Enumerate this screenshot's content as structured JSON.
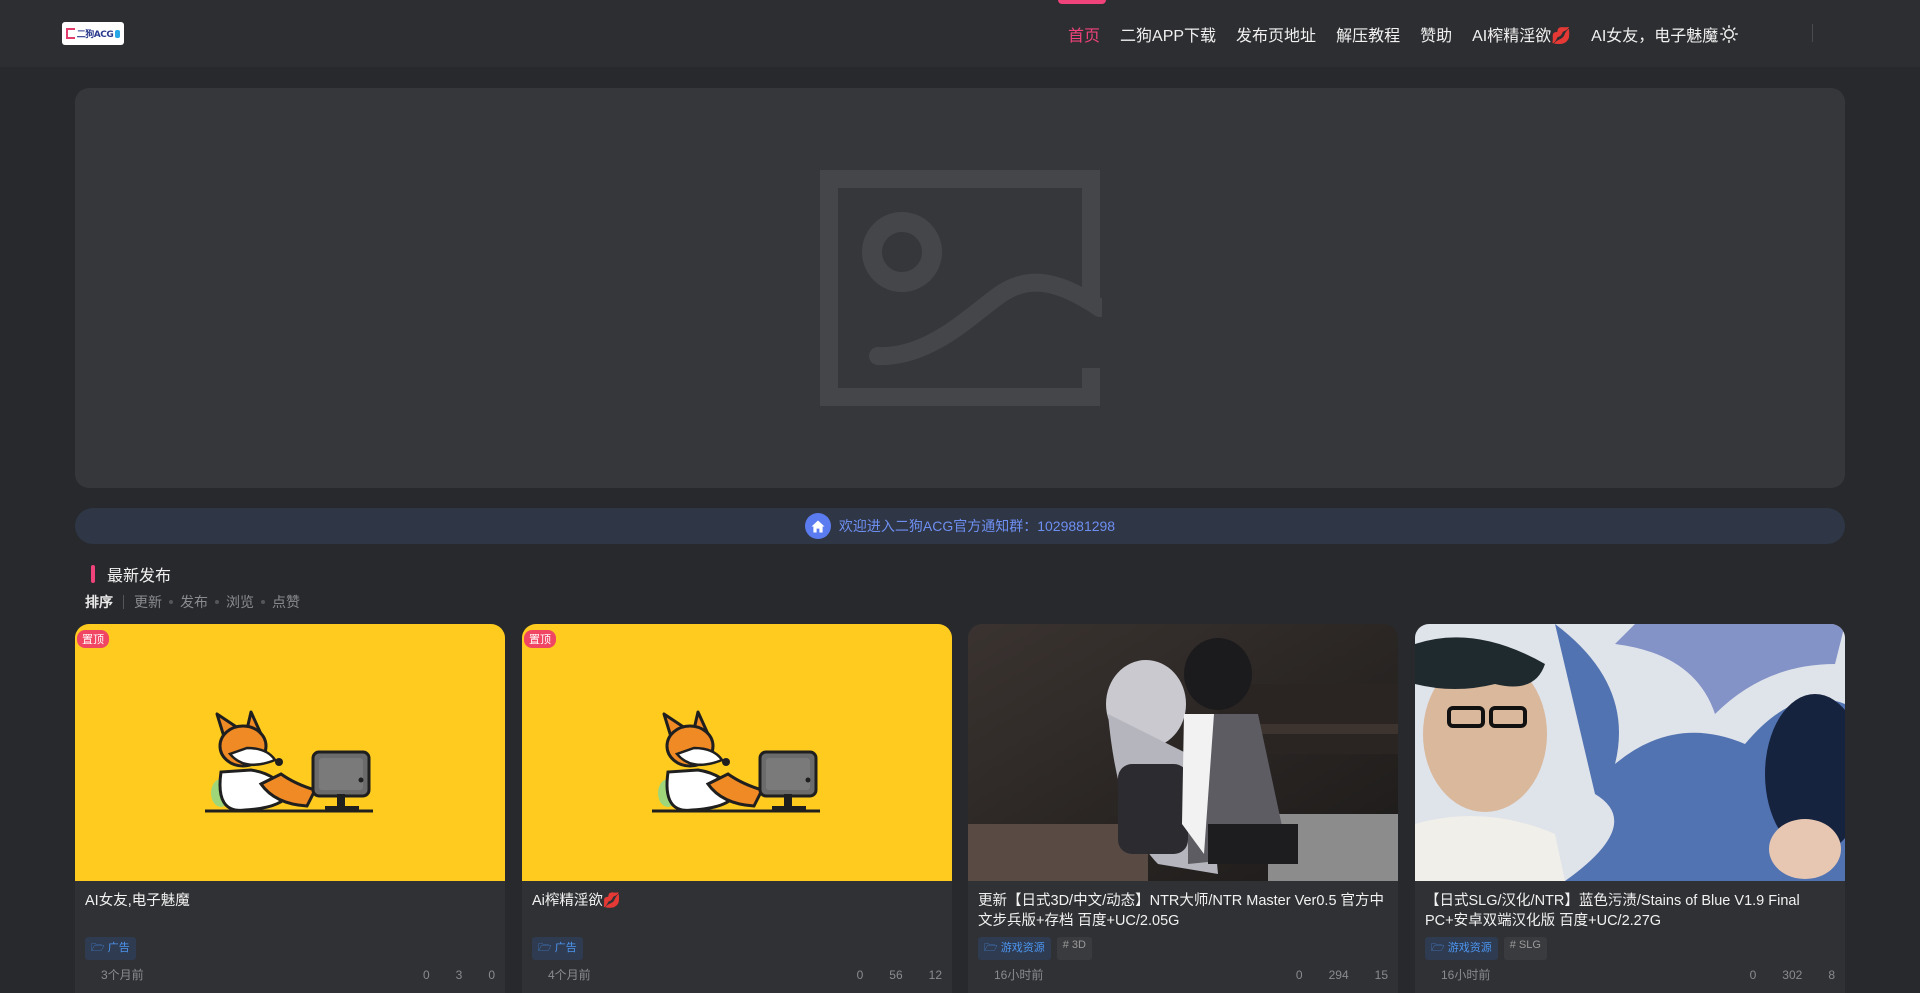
{
  "header": {
    "logo_text": "二狗ACG",
    "nav": [
      {
        "label": "首页",
        "active": true
      },
      {
        "label": "二狗APP下载",
        "active": false
      },
      {
        "label": "发布页地址",
        "active": false
      },
      {
        "label": "解压教程",
        "active": false
      },
      {
        "label": "赞助",
        "active": false
      },
      {
        "label": "AI榨精淫欲💋",
        "active": false
      },
      {
        "label": "AI女友，电子魅魔",
        "active": false
      }
    ],
    "theme_icon": "sun-icon"
  },
  "notice": {
    "icon": "home-icon",
    "text": "欢迎进入二狗ACG官方通知群：1029881298"
  },
  "section": {
    "title": "最新发布",
    "sort_label": "排序",
    "sort_options": [
      "更新",
      "发布",
      "浏览",
      "点赞"
    ]
  },
  "colors": {
    "accent": "#f0427b",
    "notice_blue": "#6e8ff2",
    "tag_blue": "#4d95f0",
    "badge_red": "#f04664",
    "ad_yellow": "#ffcb1f"
  },
  "posts": [
    {
      "badge": "置顶",
      "title": "AI女友,电子魅魔",
      "tags": [
        {
          "label": "广告",
          "kind": "cat"
        }
      ],
      "time": "3个月前",
      "comments": "0",
      "views": "3",
      "likes": "0"
    },
    {
      "badge": "置顶",
      "title": "Ai榨精淫欲💋",
      "tags": [
        {
          "label": "广告",
          "kind": "cat"
        }
      ],
      "time": "4个月前",
      "comments": "0",
      "views": "56",
      "likes": "12"
    },
    {
      "badge": "",
      "title": "更新【日式3D/中文/动态】NTR大师/NTR Master Ver0.5 官方中文步兵版+存档 百度+UC/2.05G",
      "tags": [
        {
          "label": "游戏资源",
          "kind": "cat"
        },
        {
          "label": "# 3D",
          "kind": "hash"
        }
      ],
      "time": "16小时前",
      "comments": "0",
      "views": "294",
      "likes": "15"
    },
    {
      "badge": "",
      "title": "【日式SLG/汉化/NTR】蓝色污渍/Stains of Blue V1.9 Final PC+安卓双端汉化版 百度+UC/2.27G",
      "tags": [
        {
          "label": "游戏资源",
          "kind": "cat"
        },
        {
          "label": "# SLG",
          "kind": "hash"
        }
      ],
      "time": "16小时前",
      "comments": "0",
      "views": "302",
      "likes": "8"
    }
  ]
}
